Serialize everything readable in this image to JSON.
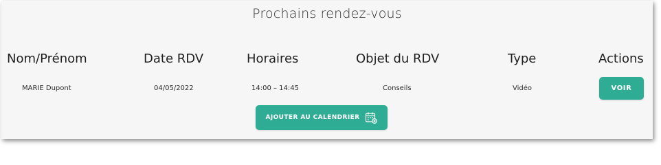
{
  "section": {
    "title": "Prochains rendez-vous"
  },
  "table": {
    "headers": [
      "Nom/Prénom",
      "Date RDV",
      "Horaires",
      "Objet du RDV",
      "Type",
      "Actions"
    ],
    "rows": [
      {
        "name": "MARIE Dupont",
        "date": "04/05/2022",
        "hours": "14:00 – 14:45",
        "object": "Conseils",
        "type": "Vidéo",
        "action_label": "VOIR"
      }
    ]
  },
  "calendar_button": {
    "label": "AJOUTER AU CALENDRIER",
    "icon": "calendar-add-icon"
  },
  "colors": {
    "accent": "#2eac94",
    "card_background": "#f6f6f6"
  }
}
